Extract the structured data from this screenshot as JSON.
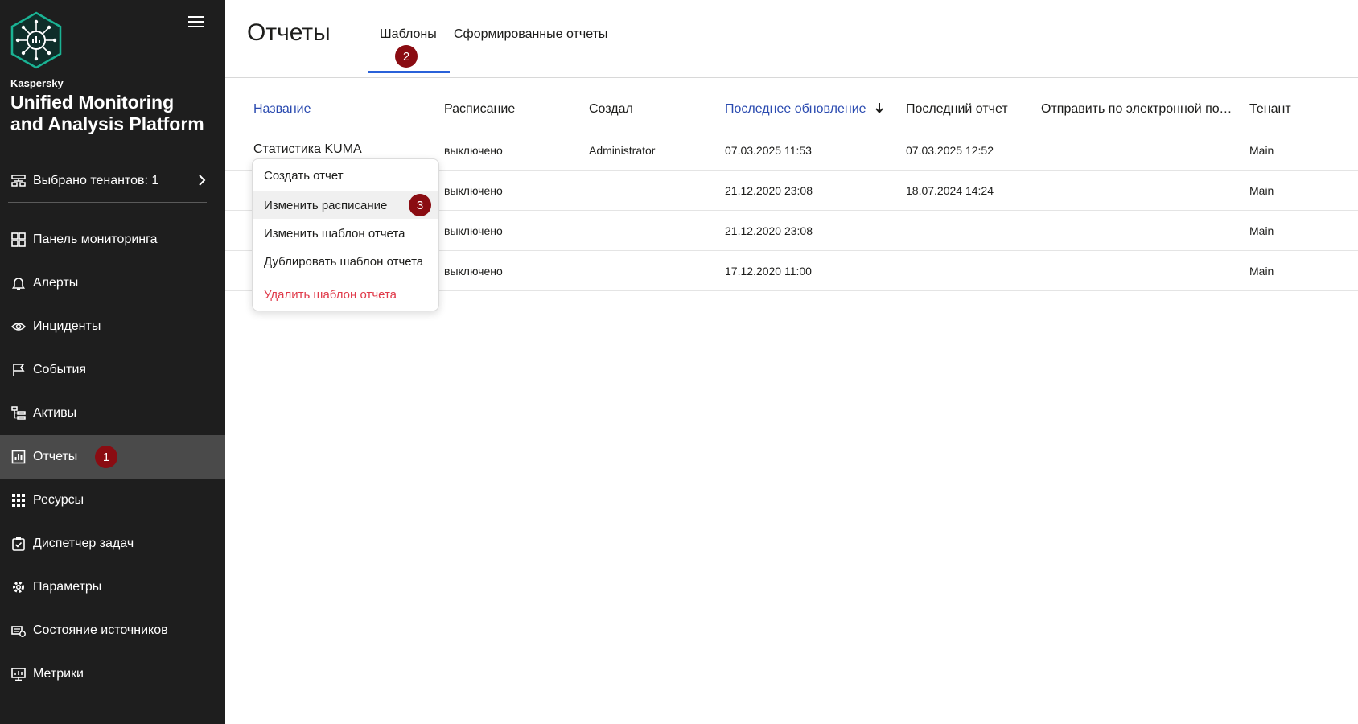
{
  "sidebar": {
    "brand_small": "Kaspersky",
    "brand_title": "Unified Monitoring and Analysis Platform",
    "tenant_label": "Выбрано тенантов: 1",
    "items": [
      {
        "label": "Панель мониторинга",
        "icon": "dashboard-icon"
      },
      {
        "label": "Алерты",
        "icon": "bell-icon"
      },
      {
        "label": "Инциденты",
        "icon": "eye-icon"
      },
      {
        "label": "События",
        "icon": "flag-icon"
      },
      {
        "label": "Активы",
        "icon": "tree-icon"
      },
      {
        "label": "Отчеты",
        "icon": "report-chart-icon",
        "active": true,
        "badge": "1"
      },
      {
        "label": "Ресурсы",
        "icon": "grid-icon"
      },
      {
        "label": "Диспетчер задач",
        "icon": "clipboard-check-icon"
      },
      {
        "label": "Параметры",
        "icon": "gear-icon"
      },
      {
        "label": "Состояние источников",
        "icon": "source-status-icon"
      },
      {
        "label": "Метрики",
        "icon": "monitor-metrics-icon"
      }
    ]
  },
  "header": {
    "title": "Отчеты",
    "tabs": [
      {
        "label": "Шаблоны",
        "active": true
      },
      {
        "label": "Сформированные отчеты",
        "active": false
      }
    ],
    "tabs_badge": "2"
  },
  "table": {
    "columns": [
      "Название",
      "Расписание",
      "Создал",
      "Последнее обновление",
      "Последний отчет",
      "Отправить по электронной поч...",
      "Тенант"
    ],
    "rows": [
      {
        "name": "Статистика KUMA",
        "schedule": "выключено",
        "creator": "Administrator",
        "updated": "07.03.2025 11:53",
        "last_report": "07.03.2025 12:52",
        "email": "",
        "tenant": "Main"
      },
      {
        "name": "",
        "schedule": "выключено",
        "creator": "",
        "updated": "21.12.2020 23:08",
        "last_report": "18.07.2024 14:24",
        "email": "",
        "tenant": "Main"
      },
      {
        "name": "",
        "schedule": "выключено",
        "creator": "",
        "updated": "21.12.2020 23:08",
        "last_report": "",
        "email": "",
        "tenant": "Main"
      },
      {
        "name": "",
        "schedule": "выключено",
        "creator": "",
        "updated": "17.12.2020 11:00",
        "last_report": "",
        "email": "",
        "tenant": "Main"
      }
    ]
  },
  "context_menu": {
    "items": [
      "Создать отчет",
      "Изменить расписание",
      "Изменить шаблон отчета",
      "Дублировать шаблон отчета",
      "Удалить шаблон отчета"
    ],
    "badge": "3"
  },
  "colors": {
    "sidebar_bg": "#1e1e1e",
    "sidebar_active": "#4a4a4a",
    "accent_blue": "#2961d9",
    "link_blue": "#2b4bb0",
    "badge_red": "#8a0c12",
    "danger": "#e03a4a",
    "logo_teal": "#1ab394"
  }
}
